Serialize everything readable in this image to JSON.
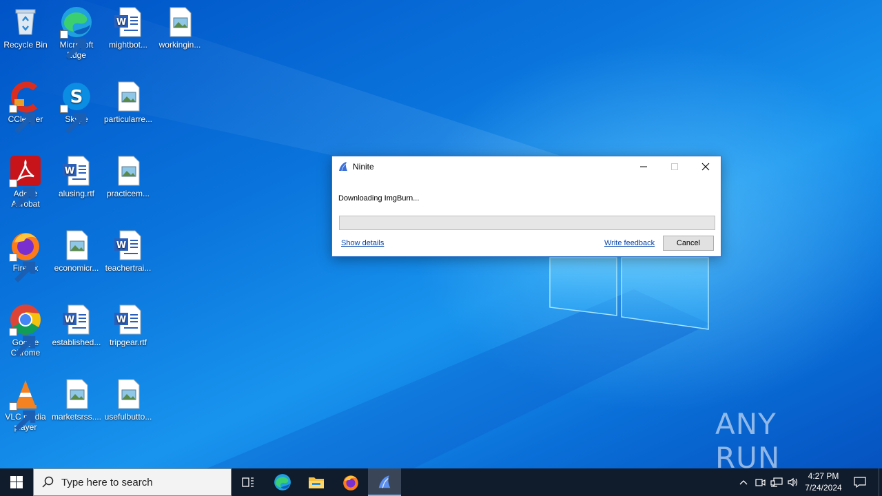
{
  "desktop": {
    "icons": [
      {
        "label": "Recycle Bin",
        "icon": "recycle-bin-icon"
      },
      {
        "label": "Microsoft Edge",
        "icon": "edge-icon"
      },
      {
        "label": "mightbot...",
        "icon": "word-doc-icon"
      },
      {
        "label": "workingin...",
        "icon": "image-file-icon"
      },
      {
        "label": "CCleaner",
        "icon": "ccleaner-icon"
      },
      {
        "label": "Skype",
        "icon": "skype-icon"
      },
      {
        "label": "particularre...",
        "icon": "image-file-icon"
      },
      {
        "label": "Adobe Acrobat",
        "icon": "acrobat-icon"
      },
      {
        "label": "alusing.rtf",
        "icon": "word-doc-icon"
      },
      {
        "label": "practicem...",
        "icon": "image-file-icon"
      },
      {
        "label": "Firefox",
        "icon": "firefox-icon"
      },
      {
        "label": "economicr...",
        "icon": "image-file-icon"
      },
      {
        "label": "teachertrai...",
        "icon": "word-doc-icon"
      },
      {
        "label": "Google Chrome",
        "icon": "chrome-icon"
      },
      {
        "label": "established...",
        "icon": "word-doc-icon"
      },
      {
        "label": "tripgear.rtf",
        "icon": "word-doc-icon"
      },
      {
        "label": "VLC media player",
        "icon": "vlc-icon"
      },
      {
        "label": "marketsrss....",
        "icon": "image-file-icon"
      },
      {
        "label": "usefulbutto...",
        "icon": "image-file-icon"
      }
    ]
  },
  "dialog": {
    "title": "Ninite",
    "status": "Downloading ImgBurn...",
    "progress": 0,
    "show_details": "Show details",
    "write_feedback": "Write feedback",
    "cancel": "Cancel"
  },
  "watermark": {
    "text": "ANY RUN"
  },
  "taskbar": {
    "search_placeholder": "Type here to search",
    "apps": [
      "task-view-icon",
      "edge-icon",
      "file-explorer-icon",
      "firefox-icon",
      "ninite-icon"
    ],
    "active_app": "ninite-icon",
    "clock_time": "4:27 PM",
    "clock_date": "7/24/2024"
  },
  "colors": {
    "taskbar": "#101b2b",
    "accent": "#0078d7",
    "link": "#0645ad"
  }
}
